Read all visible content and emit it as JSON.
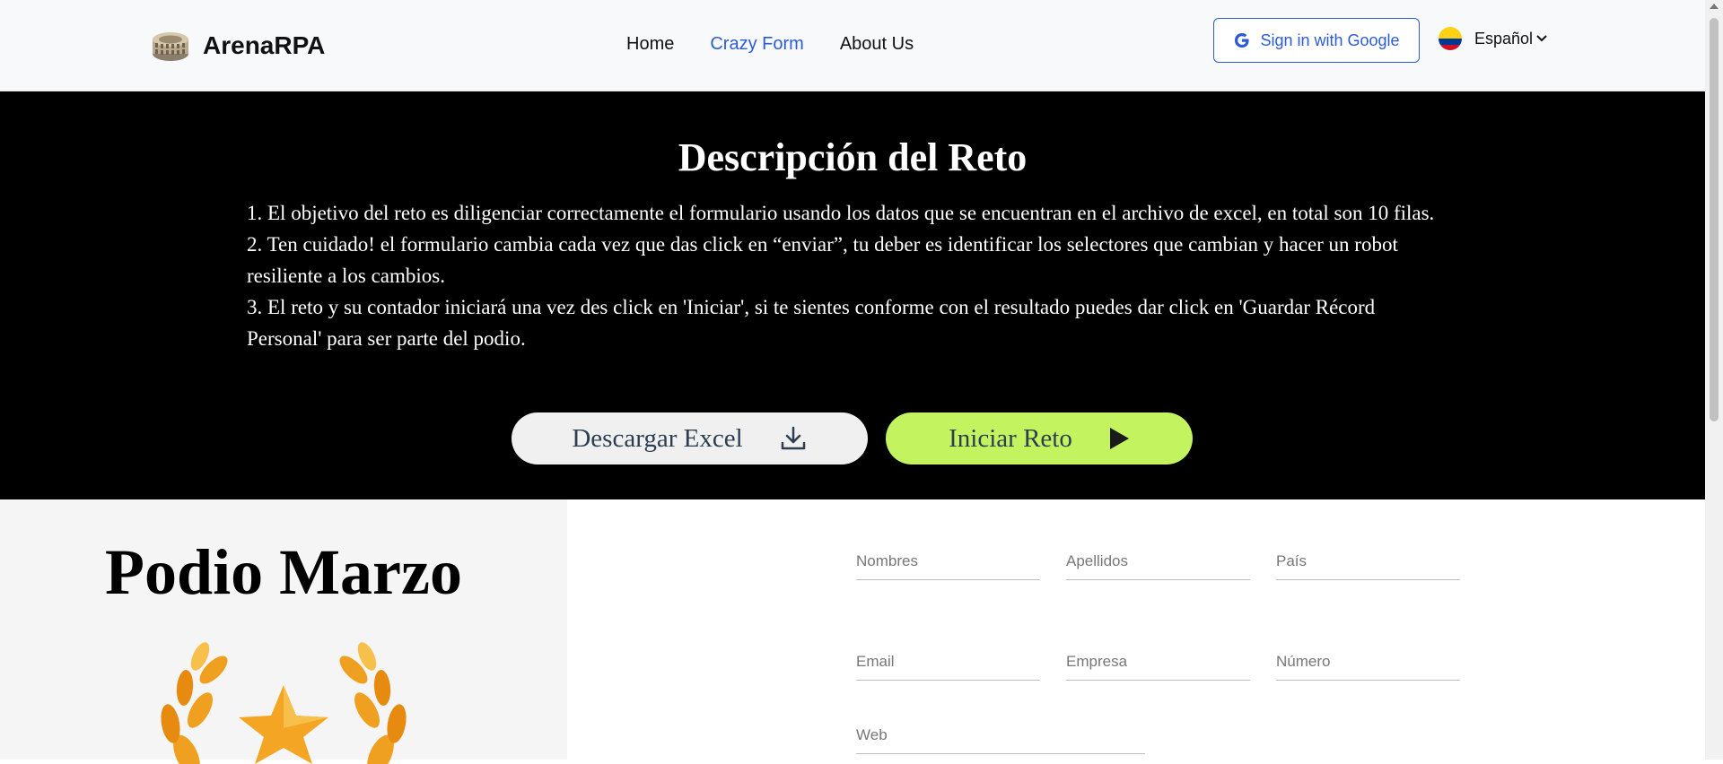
{
  "header": {
    "brand": "ArenaRPA",
    "nav": [
      {
        "label": "Home",
        "active": false
      },
      {
        "label": "Crazy Form",
        "active": true
      },
      {
        "label": "About Us",
        "active": false
      }
    ],
    "google_signin": "Sign in with Google",
    "language": "Español"
  },
  "hero": {
    "title": "Descripción del Reto",
    "points": [
      "1. El objetivo del reto es diligenciar correctamente el formulario usando los datos que se encuentran en el archivo de excel, en total son 10 filas.",
      "2. Ten cuidado! el formulario cambia cada vez que das click en “enviar”, tu deber es identificar los selectores que cambian y hacer un robot resiliente a los cambios.",
      "3. El reto y su contador iniciará una vez des click en 'Iniciar', si te sientes conforme con el resultado puedes dar click en 'Guardar Récord Personal' para ser parte del podio."
    ],
    "download_label": "Descargar Excel",
    "start_label": "Iniciar Reto"
  },
  "podium": {
    "title": "Podio Marzo"
  },
  "form": {
    "nombres": {
      "placeholder": "Nombres",
      "value": ""
    },
    "apellidos": {
      "placeholder": "Apellidos",
      "value": ""
    },
    "pais": {
      "placeholder": "País",
      "value": ""
    },
    "email": {
      "placeholder": "Email",
      "value": ""
    },
    "empresa": {
      "placeholder": "Empresa",
      "value": ""
    },
    "numero": {
      "placeholder": "Número",
      "value": ""
    },
    "web": {
      "placeholder": "Web",
      "value": ""
    }
  },
  "colors": {
    "accent": "#2b5bd7",
    "start_button": "#c3f35f",
    "hero_bg": "#000000"
  }
}
